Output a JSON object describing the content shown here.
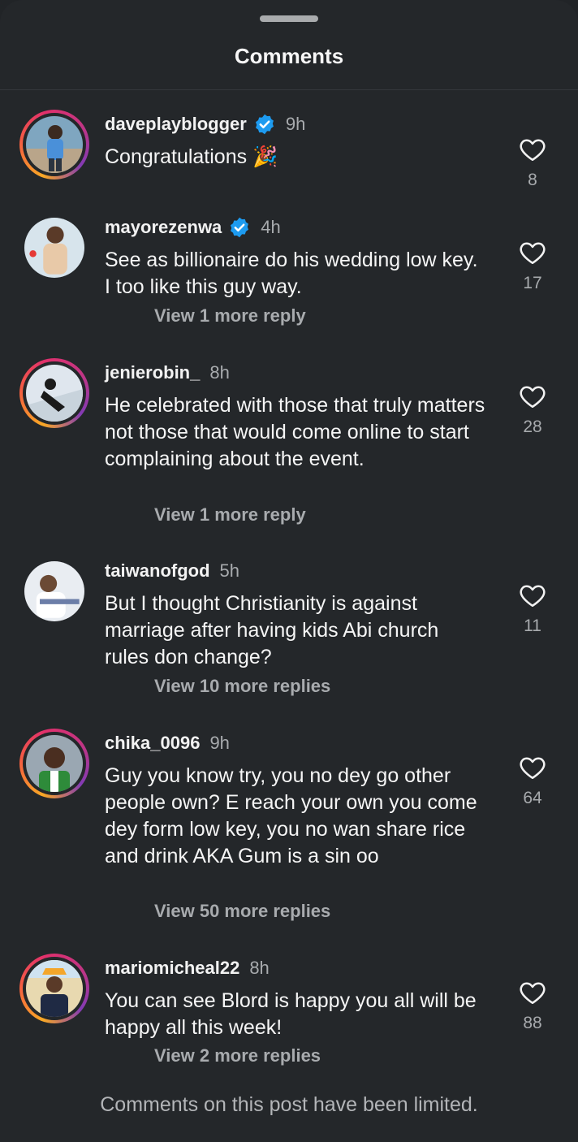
{
  "header": {
    "title": "Comments"
  },
  "comments": [
    {
      "username": "daveplayblogger",
      "verified": true,
      "time": "9h",
      "text": "Congratulations 🎉",
      "more": "",
      "likes": "8"
    },
    {
      "username": "mayorezenwa",
      "verified": true,
      "time": "4h",
      "text": "See as billionaire do his wedding low key.  I too like this guy way.",
      "more": "View 1 more reply",
      "likes": "17"
    },
    {
      "username": "jenierobin_",
      "verified": false,
      "time": "8h",
      "text": "He celebrated with those that truly matters not those that would come online to start complaining about the event.",
      "more": "View 1 more reply",
      "likes": "28"
    },
    {
      "username": "taiwanofgod",
      "verified": false,
      "time": "5h",
      "text": "But I thought Christianity is against marriage after having kids Abi church rules don change?",
      "more": "View 10 more replies",
      "likes": "11"
    },
    {
      "username": "chika_0096",
      "verified": false,
      "time": "9h",
      "text": "Guy you know try, you no dey go other people own? E reach your own you come dey form low key, you no wan share rice and drink AKA Gum is a sin oo",
      "more": "View 50 more replies",
      "likes": "64"
    },
    {
      "username": "mariomicheal22",
      "verified": false,
      "time": "8h",
      "text": "You can see Blord is happy you all will be happy all this week!",
      "more": "View 2 more replies",
      "likes": "88"
    }
  ],
  "footer": {
    "limited_text": "Comments on this post have been limited."
  },
  "colors": {
    "background": "#24272a",
    "verified_badge": "#1d9bf0",
    "secondary_text": "#a8abae",
    "story_ring": "#e1306c"
  },
  "icons": {
    "like": "heart-outline-icon",
    "verified": "verified-badge-icon"
  }
}
